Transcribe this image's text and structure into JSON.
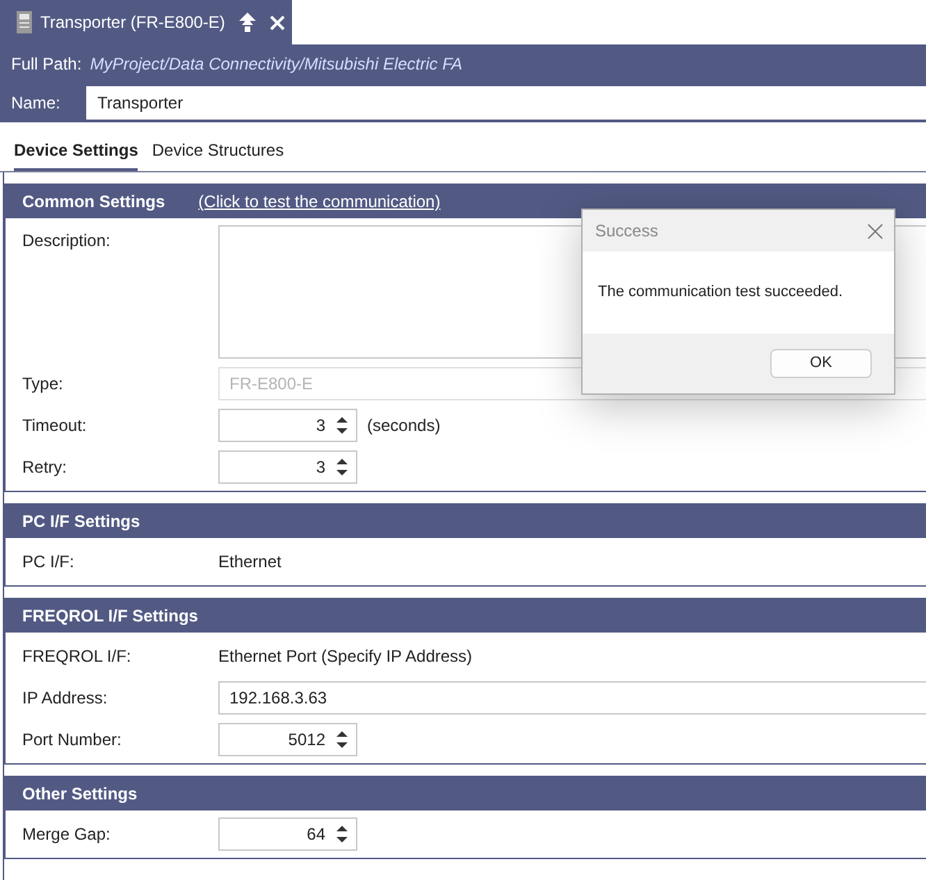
{
  "tab": {
    "title": "Transporter (FR-E800-E)"
  },
  "header": {
    "full_path_label": "Full Path:",
    "full_path": "MyProject/Data Connectivity/Mitsubishi Electric FA",
    "name_label": "Name:",
    "name_value": "Transporter"
  },
  "tabs": [
    {
      "label": "Device Settings",
      "selected": true
    },
    {
      "label": "Device Structures",
      "selected": false
    }
  ],
  "sections": [
    {
      "title": "Common Settings",
      "link": "(Click to test the communication)",
      "fields": [
        {
          "kind": "textarea",
          "label": "Description:"
        },
        {
          "kind": "text",
          "label": "Type:",
          "value": "FR-E800-E",
          "disabled": true
        },
        {
          "kind": "spin",
          "label": "Timeout:",
          "value": "3",
          "unit": "(seconds)"
        },
        {
          "kind": "spin",
          "label": "Retry:",
          "value": "3"
        }
      ]
    },
    {
      "title": "PC I/F Settings",
      "fields": [
        {
          "kind": "static",
          "label": "PC I/F:",
          "value": "Ethernet"
        }
      ]
    },
    {
      "title": "FREQROL I/F Settings",
      "fields": [
        {
          "kind": "static",
          "label": "FREQROL I/F:",
          "value": "Ethernet Port (Specify IP Address)"
        },
        {
          "kind": "text",
          "label": "IP Address:",
          "value": "192.168.3.63",
          "disabled": false
        },
        {
          "kind": "spin",
          "label": "Port Number:",
          "value": "5012"
        }
      ]
    },
    {
      "title": "Other Settings",
      "fields": [
        {
          "kind": "spin",
          "label": "Merge Gap:",
          "value": "64"
        }
      ]
    }
  ],
  "dialog": {
    "title": "Success",
    "message": "The communication test succeeded.",
    "button": "OK"
  }
}
